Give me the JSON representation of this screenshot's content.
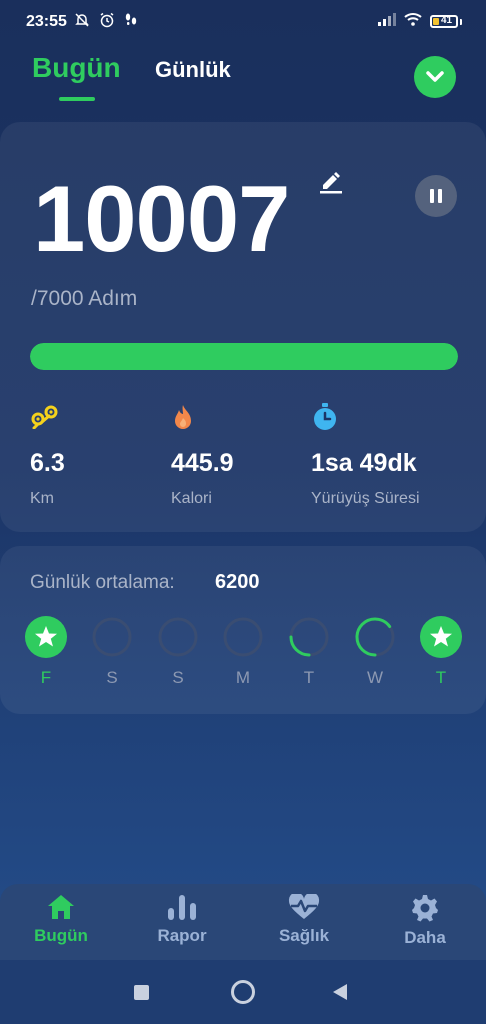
{
  "status_bar": {
    "time": "23:55",
    "battery_level": "41"
  },
  "tabs": {
    "today": "Bugün",
    "daily": "Günlük"
  },
  "main": {
    "steps": "10007",
    "goal_text": "/7000 Adım",
    "progress_fraction": 1.0,
    "stats": [
      {
        "icon": "route-icon",
        "value": "6.3",
        "label": "Km"
      },
      {
        "icon": "flame-icon",
        "value": "445.9",
        "label": "Kalori"
      },
      {
        "icon": "stopwatch-icon",
        "value": "1sa 49dk",
        "label": "Yürüyüş Süresi"
      }
    ]
  },
  "weekly": {
    "average_label": "Günlük ortalama:",
    "average_value": "6200",
    "days": [
      {
        "label": "F",
        "state": "goal-reached"
      },
      {
        "label": "S",
        "state": "progress",
        "progress": 0
      },
      {
        "label": "S",
        "state": "progress",
        "progress": 0
      },
      {
        "label": "M",
        "state": "progress",
        "progress": 0
      },
      {
        "label": "T",
        "state": "progress",
        "progress": 0.25
      },
      {
        "label": "W",
        "state": "progress",
        "progress": 0.65
      },
      {
        "label": "T",
        "state": "goal-reached"
      }
    ]
  },
  "bottom_nav": {
    "items": [
      {
        "label": "Bugün",
        "icon": "home-icon",
        "active": true
      },
      {
        "label": "Rapor",
        "icon": "bar-chart-icon",
        "active": false
      },
      {
        "label": "Sağlık",
        "icon": "heart-pulse-icon",
        "active": false
      },
      {
        "label": "Daha",
        "icon": "gear-icon",
        "active": false
      }
    ]
  },
  "colors": {
    "accent": "#2fcc5f",
    "background_top": "#1a2f5c",
    "background_bottom": "#25508f",
    "muted_text": "#aab4c8"
  }
}
